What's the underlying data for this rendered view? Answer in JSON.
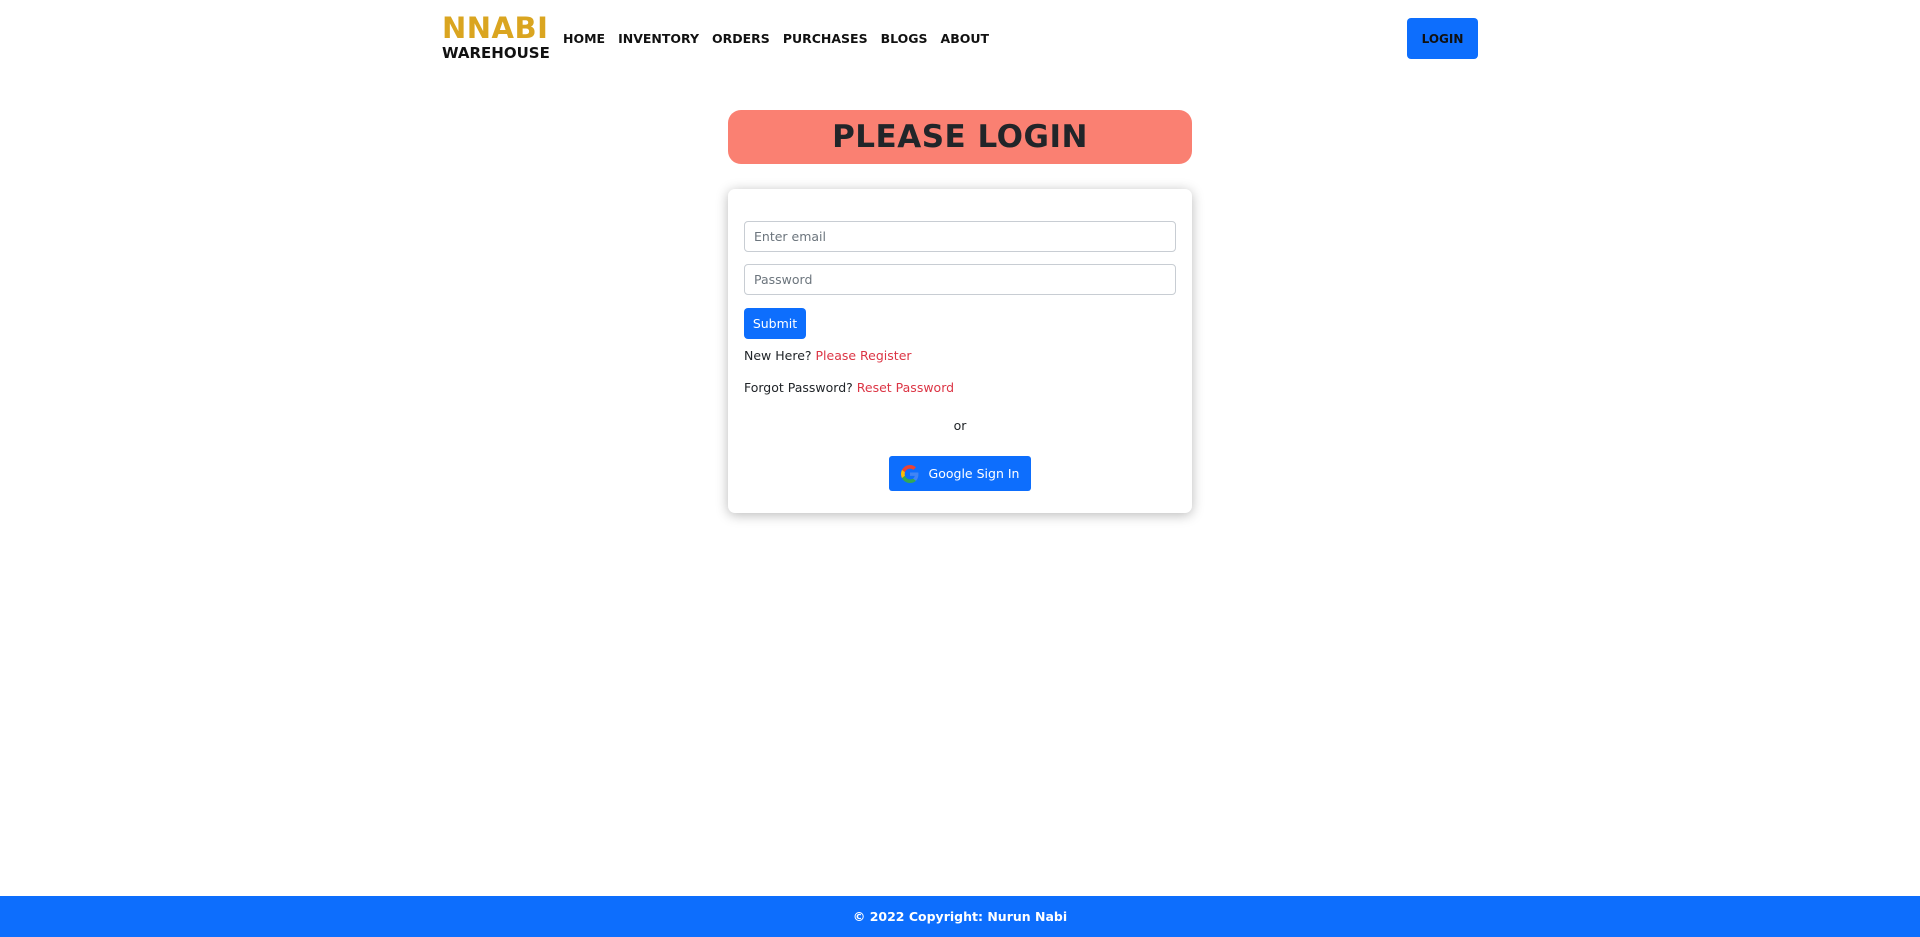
{
  "header": {
    "brand_top": "NNABI",
    "brand_bottom": "WAREHOUSE",
    "nav": [
      {
        "label": "HOME"
      },
      {
        "label": "INVENTORY"
      },
      {
        "label": "ORDERS"
      },
      {
        "label": "PURCHASES"
      },
      {
        "label": "BLOGS"
      },
      {
        "label": "ABOUT"
      }
    ],
    "login_label": "LOGIN"
  },
  "main": {
    "title": "PLEASE LOGIN",
    "form": {
      "email_placeholder": "Enter email",
      "email_value": "",
      "password_placeholder": "Password",
      "password_value": "",
      "submit_label": "Submit",
      "register_prompt": "New Here?",
      "register_link": "Please Register",
      "reset_prompt": "Forgot Password?",
      "reset_link": "Reset Password",
      "or_text": "or",
      "google_label": "Google Sign In",
      "google_icon": "google-icon"
    }
  },
  "footer": {
    "text": "© 2022 Copyright: Nurun Nabi"
  },
  "colors": {
    "brand_gold": "#daa520",
    "primary_blue": "#0d6efd",
    "banner_salmon": "#fa8072",
    "link_red": "#dc3545"
  }
}
